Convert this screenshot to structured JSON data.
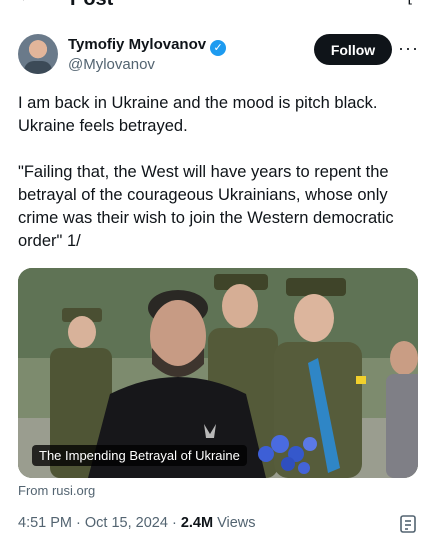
{
  "header": {
    "title": "Post",
    "back_icon": "arrow-left-icon"
  },
  "author": {
    "name": "Tymofiy Mylovanov",
    "handle": "@Mylovanov",
    "verified_icon": "verified-badge-icon",
    "follow_label": "Follow",
    "more_icon": "more-options-icon"
  },
  "tweet": {
    "line1": "I am back in Ukraine and the mood is pitch black. Ukraine feels betrayed.",
    "line2": "\"Failing that, the West will have years to repent the betrayal of the courageous Ukrainians, whose only crime was their wish to join the Western democratic order\" 1/"
  },
  "link_card": {
    "title": "The Impending Betrayal of Ukraine",
    "source": "From rusi.org"
  },
  "meta": {
    "time": "4:51 PM",
    "separator": " · ",
    "date": "Oct 15, 2024",
    "views_count": "2.4M",
    "views_label": " Views"
  },
  "colors": {
    "accent": "#1d9bf0",
    "text": "#0f1419",
    "muted": "#536471",
    "button_bg": "#0f1419"
  }
}
